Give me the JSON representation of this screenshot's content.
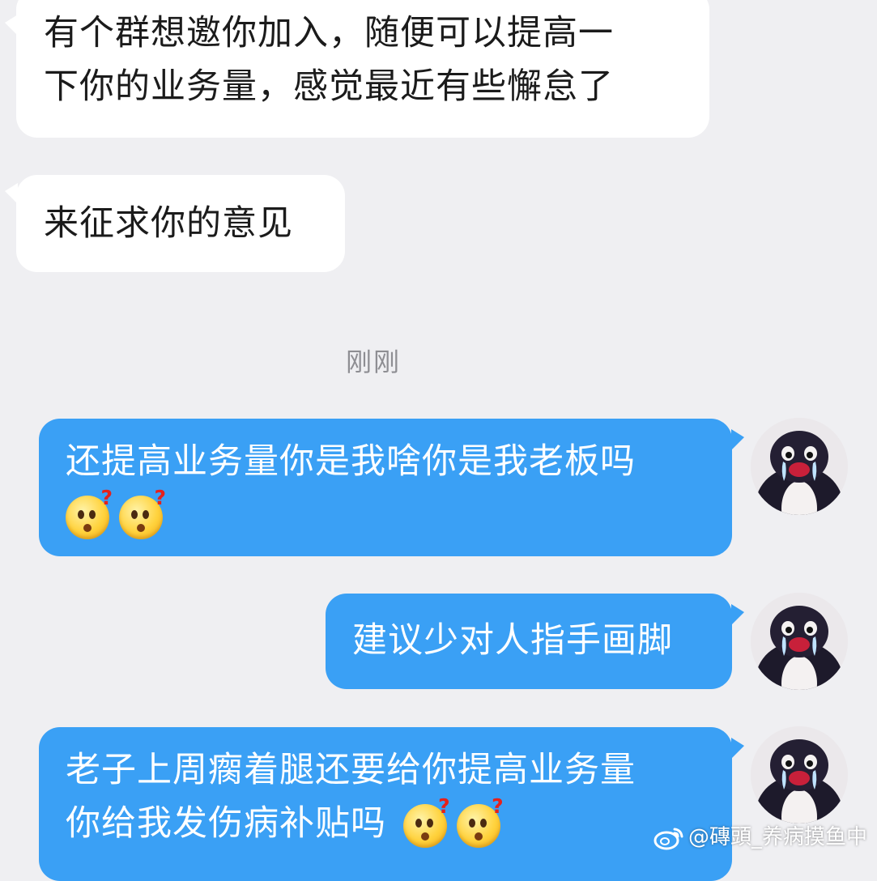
{
  "conversation": {
    "incoming": [
      {
        "lines": [
          "有个群想邀你加入，随便可以提高一",
          "下你的业务量，感觉最近有些懈怠了"
        ]
      },
      {
        "lines": [
          "来征求你的意见"
        ]
      }
    ],
    "timestamp": "刚刚",
    "outgoing": [
      {
        "lines": [
          "还提高业务量你是我啥你是我老板吗"
        ],
        "emojis": [
          "confused-face-emoji",
          "confused-face-emoji"
        ]
      },
      {
        "lines": [
          "建议少对人指手画脚"
        ],
        "emojis": []
      },
      {
        "lines": [
          "老子上周瘸着腿还要给你提高业务量",
          "你给我发伤病补贴吗"
        ],
        "emojis": [
          "confused-face-emoji",
          "confused-face-emoji"
        ]
      }
    ],
    "emoji_glyph": "?"
  },
  "watermark": {
    "text": "@磚頭_养病摸鱼中"
  },
  "colors": {
    "background": "#efeff2",
    "incoming_bubble": "#ffffff",
    "outgoing_bubble": "#3aa0f5",
    "timestamp_text": "#8e8e93"
  }
}
